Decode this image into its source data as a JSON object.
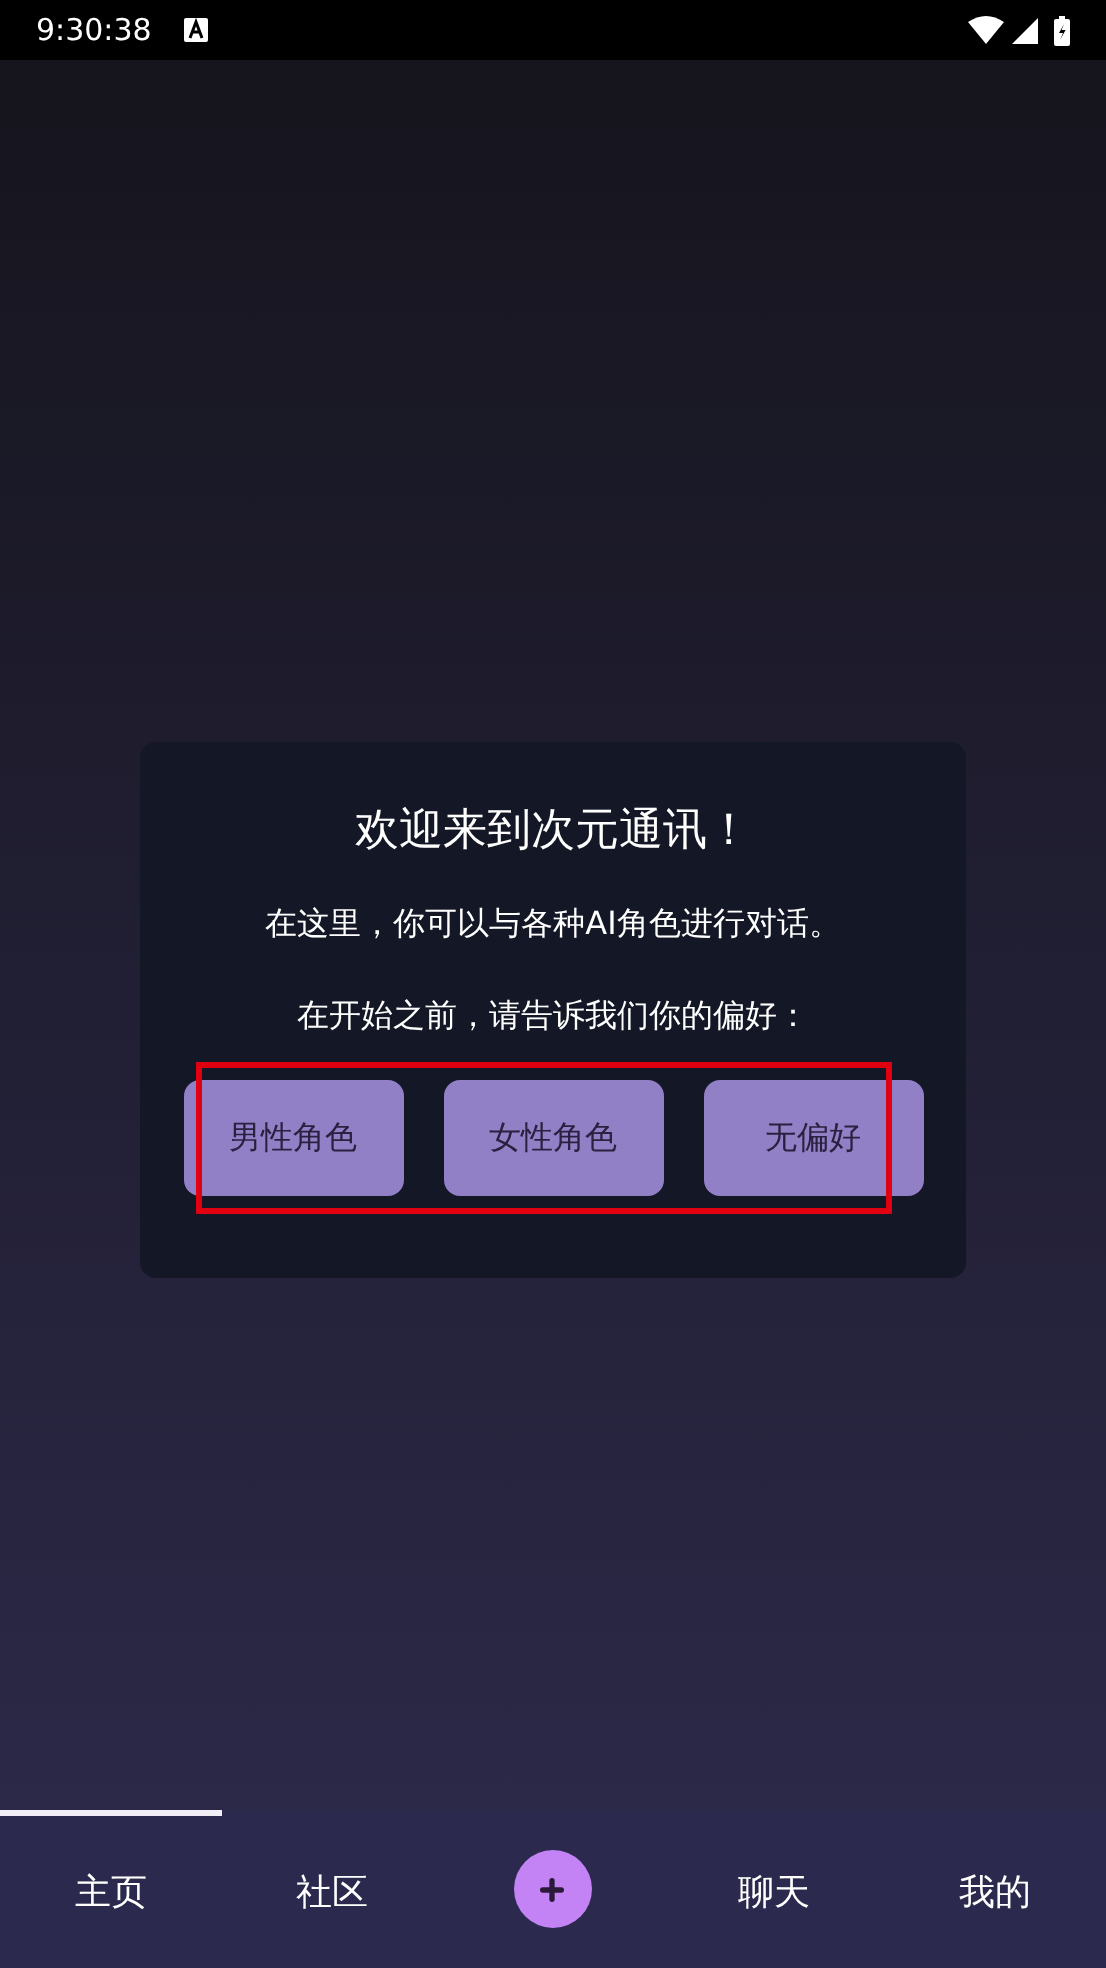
{
  "status_bar": {
    "time": "9:30:38"
  },
  "dialog": {
    "title": "欢迎来到次元通讯！",
    "message": "在这里，你可以与各种AI角色进行对话。",
    "prompt": "在开始之前，请告诉我们你的偏好：",
    "options_highlighted": true,
    "options": [
      "男性角色",
      "女性角色",
      "无偏好"
    ]
  },
  "bottom_nav": [
    {
      "kind": "tab",
      "label": "主页",
      "selected": true
    },
    {
      "kind": "tab",
      "label": "社区",
      "selected": false
    },
    {
      "kind": "add",
      "selected": false
    },
    {
      "kind": "tab",
      "label": "聊天",
      "selected": false
    },
    {
      "kind": "tab",
      "label": "我的",
      "selected": false
    }
  ]
}
